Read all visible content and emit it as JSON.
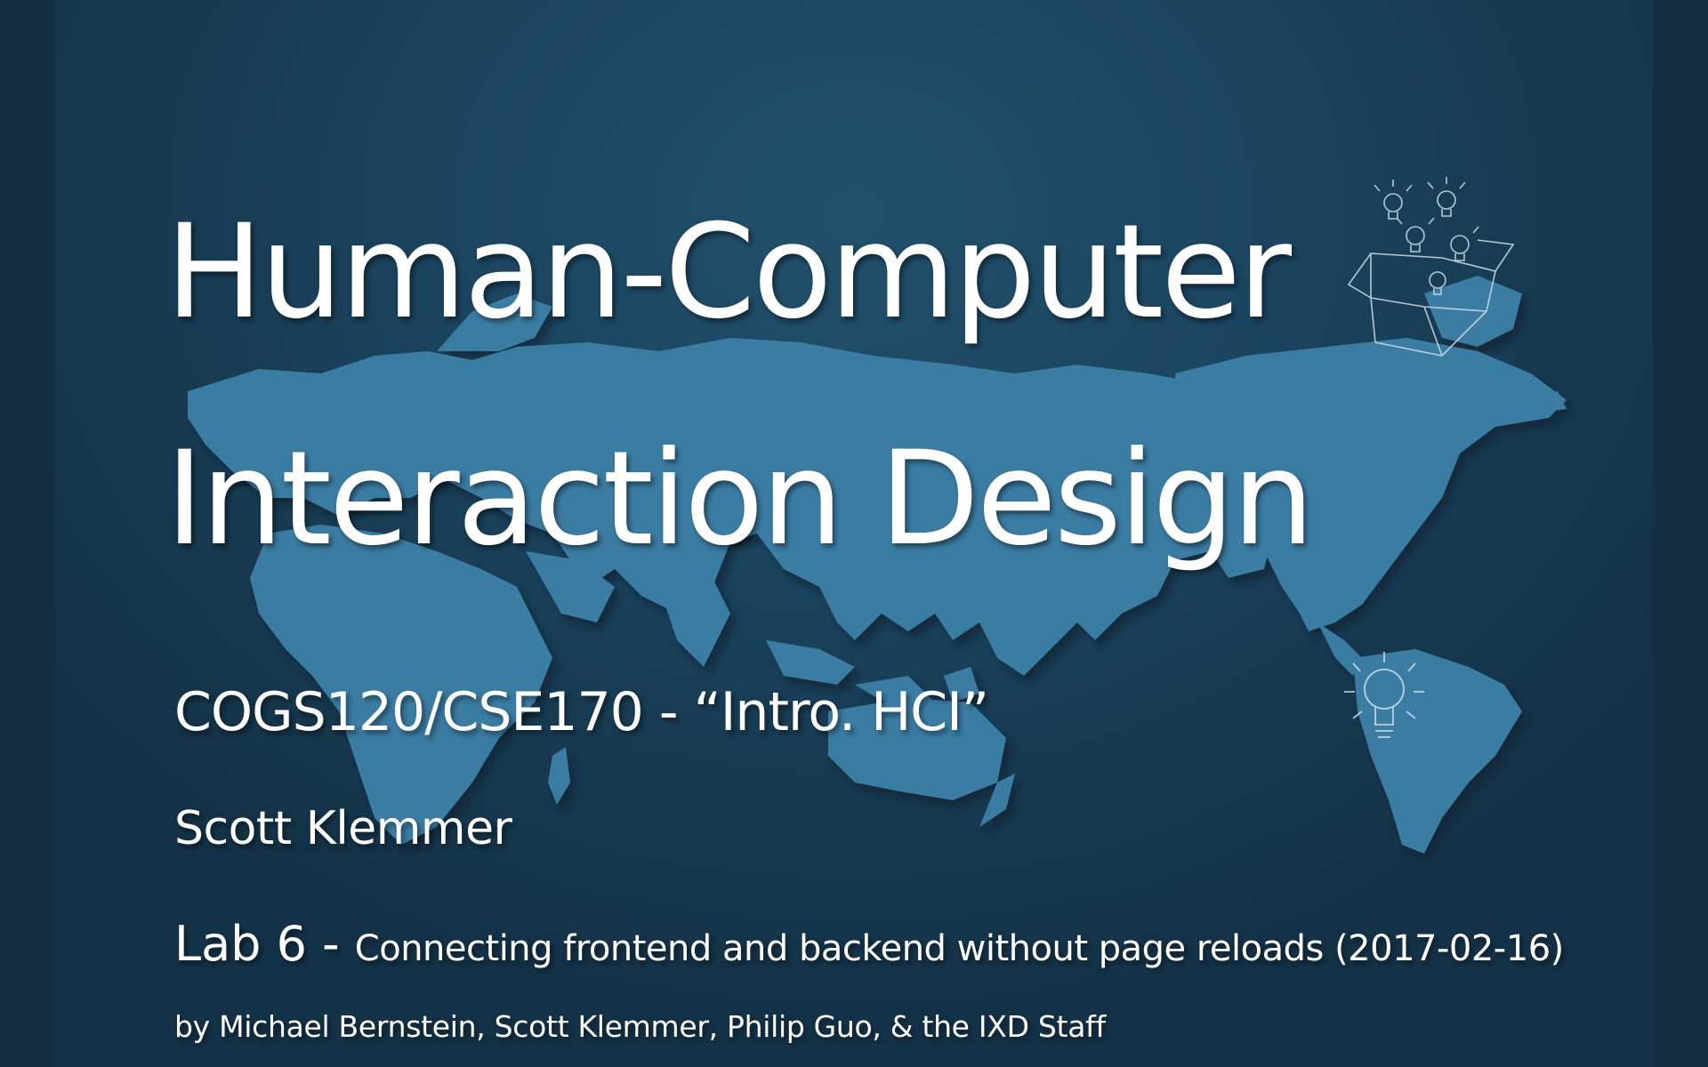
{
  "slide": {
    "title_line1": "Human-Computer",
    "title_line2": "Interaction Design",
    "course": "COGS120/CSE170 - “Intro. HCI”",
    "author": "Scott Klemmer",
    "lab_label": "Lab 6 - ",
    "lab_description": "Connecting frontend and backend without page reloads (2017-02-16)",
    "credits": "by Michael Bernstein, Scott Klemmer, Philip Guo, & the IXD Staff"
  },
  "colors": {
    "background": "#1b4560",
    "map": "#3a7ba3",
    "text": "#ffffff"
  },
  "icons": [
    "world-map-icon",
    "lightbulb-box-icon",
    "lightbulb-icon"
  ]
}
